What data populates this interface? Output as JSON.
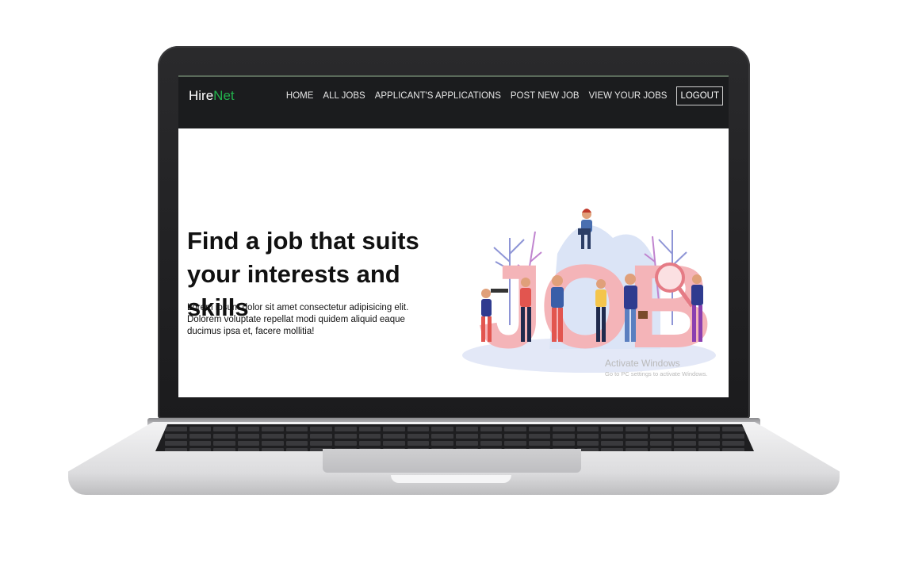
{
  "brand": {
    "first": "Hire",
    "second": "Net",
    "accent_color": "#22b14c"
  },
  "nav": {
    "items": [
      {
        "label": "HOME"
      },
      {
        "label": "ALL JOBS"
      },
      {
        "label": "APPLICANT'S APPLICATIONS"
      },
      {
        "label": "POST NEW JOB"
      },
      {
        "label": "VIEW YOUR JOBS"
      }
    ],
    "logout_label": "LOGOUT"
  },
  "hero": {
    "title_line1": "Find a job that suits",
    "title_line2": "your interests and skills",
    "body": "Lorem ipsum dolor sit amet consectetur adipisicing elit. Dolorem voluptate repellat modi quidem aliquid eaque ducimus ipsa et, facere mollitia!",
    "illustration_letters": "JOB"
  },
  "watermark": {
    "title": "Activate Windows",
    "subtitle": "Go to PC settings to activate Windows."
  },
  "colors": {
    "navbar": "#1b1c1e",
    "letters": "#f4b4b8",
    "page": "#ffffff"
  }
}
